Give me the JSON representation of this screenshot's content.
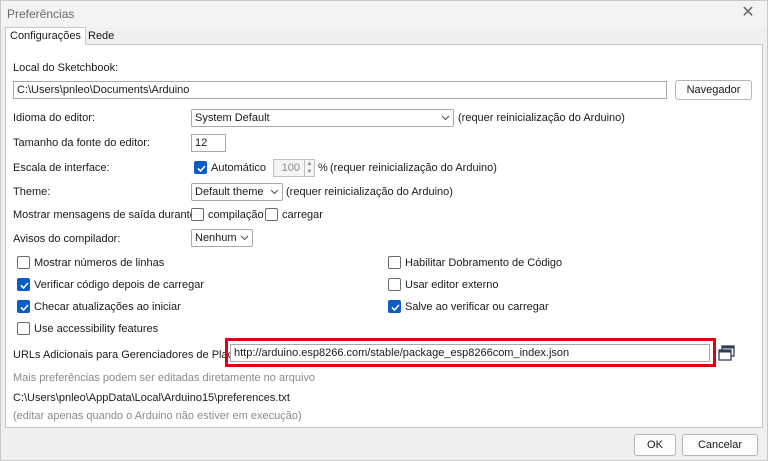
{
  "window": {
    "title": "Preferências"
  },
  "tabs": [
    {
      "label": "Configurações",
      "active": true
    },
    {
      "label": "Rede",
      "active": false
    }
  ],
  "sketchbook": {
    "label": "Local do Sketchbook:",
    "path": "C:\\Users\\pnleo\\Documents\\Arduino",
    "browse_label": "Navegador"
  },
  "editor_language": {
    "label": "Idioma do editor:",
    "value": "System Default",
    "note": "(requer reinicialização do Arduino)"
  },
  "font_size": {
    "label": "Tamanho da fonte do editor:",
    "value": "12"
  },
  "interface_scale": {
    "label": "Escala de interface:",
    "auto_label": "Automático",
    "auto_checked": true,
    "value": "100",
    "unit": "%",
    "note": "(requer reinicialização do Arduino)"
  },
  "theme": {
    "label": "Theme:",
    "value": "Default theme",
    "note": "(requer reinicialização do Arduino)"
  },
  "verbose_output": {
    "label": "Mostrar mensagens de saída durante:",
    "compile_label": "compilação",
    "compile_checked": false,
    "upload_label": "carregar",
    "upload_checked": false
  },
  "compiler_warnings": {
    "label": "Avisos do compilador:",
    "value": "Nenhum"
  },
  "options_left": [
    {
      "label": "Mostrar números de linhas",
      "checked": false
    },
    {
      "label": "Verificar código depois de carregar",
      "checked": true
    },
    {
      "label": "Checar atualizações ao iniciar",
      "checked": true
    },
    {
      "label": "Use accessibility features",
      "checked": false
    }
  ],
  "options_right": [
    {
      "label": "Habilitar Dobramento de Código",
      "checked": false
    },
    {
      "label": "Usar editor externo",
      "checked": false
    },
    {
      "label": "Salve ao verificar ou carregar",
      "checked": true
    }
  ],
  "board_urls": {
    "label": "URLs Adicionais para Gerenciadores de Placas:",
    "value": "http://arduino.esp8266.com/stable/package_esp8266com_index.json"
  },
  "footer_notes": {
    "more_prefs": "Mais preferências podem ser editadas diretamente no arquivo",
    "prefs_path": "C:\\Users\\pnleo\\AppData\\Local\\Arduino15\\preferences.txt",
    "edit_hint": "(editar apenas quando o Arduino não estiver em execução)"
  },
  "buttons": {
    "ok": "OK",
    "cancel": "Cancelar"
  },
  "colors": {
    "accent": "#0b5cc5",
    "highlight": "#e3000f"
  }
}
